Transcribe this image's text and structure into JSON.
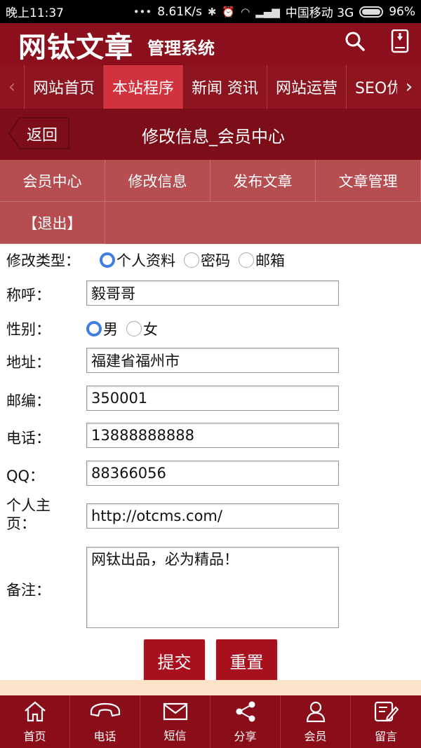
{
  "status_bar": {
    "time": "晚上11:37",
    "speed": "8.61K/s",
    "carrier": "中国移动 3G",
    "battery": "96%"
  },
  "header": {
    "logo_main": "网钛文章",
    "logo_sub": "管理系统",
    "icons": [
      "search-icon",
      "mobile-download-icon"
    ]
  },
  "nav": {
    "items": [
      {
        "label": "网站首页"
      },
      {
        "label": "本站程序",
        "active": true
      },
      {
        "label": "新闻 资讯"
      },
      {
        "label": "网站运营"
      },
      {
        "label": "SEO优化"
      }
    ]
  },
  "titlebar": {
    "back_label": "返回",
    "title": "修改信息_会员中心"
  },
  "submenu": {
    "items": [
      {
        "label": "会员中心"
      },
      {
        "label": "修改信息"
      },
      {
        "label": "发布文章"
      },
      {
        "label": "文章管理"
      },
      {
        "label": "【退出】"
      }
    ]
  },
  "form": {
    "type_label": "修改类型：",
    "type_options": [
      {
        "label": "个人资料",
        "checked": true
      },
      {
        "label": "密码",
        "checked": false
      },
      {
        "label": "邮箱",
        "checked": false
      }
    ],
    "nickname_label": "称呼：",
    "nickname_value": "毅哥哥",
    "gender_label": "性别：",
    "gender_options": [
      {
        "label": "男",
        "checked": true
      },
      {
        "label": "女",
        "checked": false
      }
    ],
    "address_label": "地址：",
    "address_value": "福建省福州市",
    "postcode_label": "邮编：",
    "postcode_value": "350001",
    "phone_label": "电话：",
    "phone_value": "13888888888",
    "qq_label": "QQ：",
    "qq_value": "88366056",
    "homepage_label_1": "个人主",
    "homepage_label_2": "页：",
    "homepage_value": "http://otcms.com/",
    "note_label": "备注：",
    "note_value": "网钛出品，必为精品！",
    "submit_label": "提交",
    "reset_label": "重置"
  },
  "bottom_bar": {
    "items": [
      {
        "label": "首页",
        "icon": "home-icon"
      },
      {
        "label": "电话",
        "icon": "phone-icon"
      },
      {
        "label": "短信",
        "icon": "mail-icon"
      },
      {
        "label": "分享",
        "icon": "share-icon"
      },
      {
        "label": "会员",
        "icon": "user-icon"
      },
      {
        "label": "留言",
        "icon": "edit-icon"
      }
    ]
  }
}
